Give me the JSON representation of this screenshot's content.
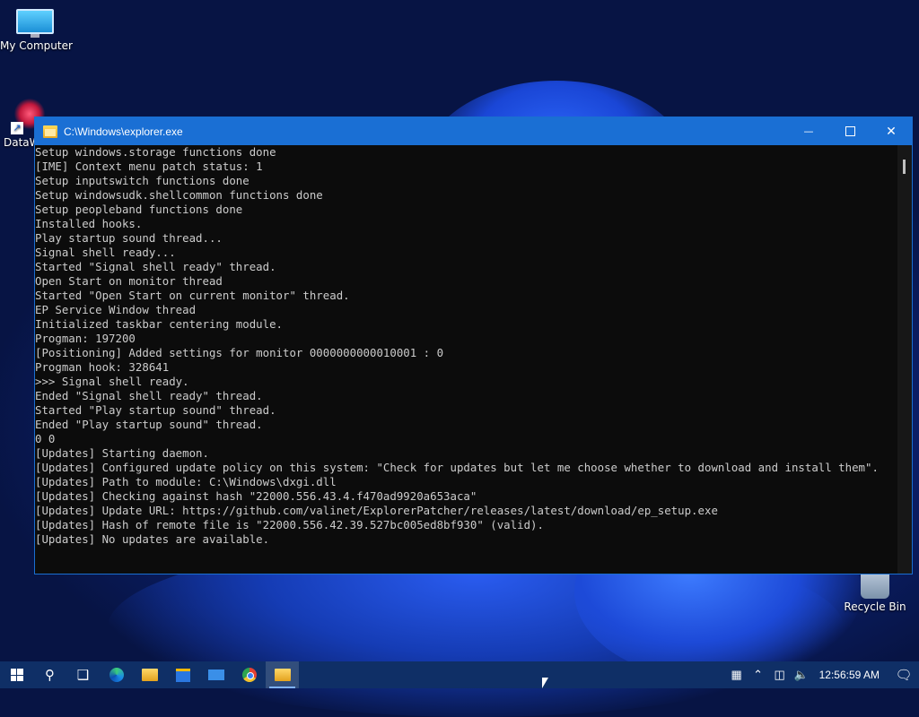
{
  "desktop": {
    "icons": [
      {
        "label": "My Computer"
      },
      {
        "label": "DataW"
      },
      {
        "label": "Recycle Bin"
      }
    ]
  },
  "window": {
    "title": "C:\\Windows\\explorer.exe",
    "controls": {
      "minimize": "—",
      "close": "✕"
    }
  },
  "console": {
    "lines": [
      "Setup windows.storage functions done",
      "[IME] Context menu patch status: 1",
      "Setup inputswitch functions done",
      "Setup windowsudk.shellcommon functions done",
      "Setup peopleband functions done",
      "Installed hooks.",
      "Play startup sound thread...",
      "Signal shell ready...",
      "Started \"Signal shell ready\" thread.",
      "Open Start on monitor thread",
      "Started \"Open Start on current monitor\" thread.",
      "EP Service Window thread",
      "Initialized taskbar centering module.",
      "Progman: 197200",
      "[Positioning] Added settings for monitor 0000000000010001 : 0",
      "Progman hook: 328641",
      ">>> Signal shell ready.",
      "Ended \"Signal shell ready\" thread.",
      "Started \"Play startup sound\" thread.",
      "Ended \"Play startup sound\" thread.",
      "0 0",
      "[Updates] Starting daemon.",
      "[Updates] Configured update policy on this system: \"Check for updates but let me choose whether to download and install them\".",
      "[Updates] Path to module: C:\\Windows\\dxgi.dll",
      "[Updates] Checking against hash \"22000.556.43.4.f470ad9920a653aca\"",
      "[Updates] Update URL: https://github.com/valinet/ExplorerPatcher/releases/latest/download/ep_setup.exe",
      "[Updates] Hash of remote file is \"22000.556.42.39.527bc005ed8bf930\" (valid).",
      "[Updates] No updates are available."
    ]
  },
  "taskbar": {
    "clock": "12:56:59 AM",
    "items": [
      "start",
      "search",
      "task-view",
      "edge",
      "file-explorer",
      "store",
      "mail",
      "chrome",
      "explorer-console"
    ]
  },
  "colors": {
    "titlebar": "#1a6fd4",
    "console_bg": "#0c0c0c",
    "console_text": "#cccccc",
    "taskbar": "#0f2f66"
  }
}
